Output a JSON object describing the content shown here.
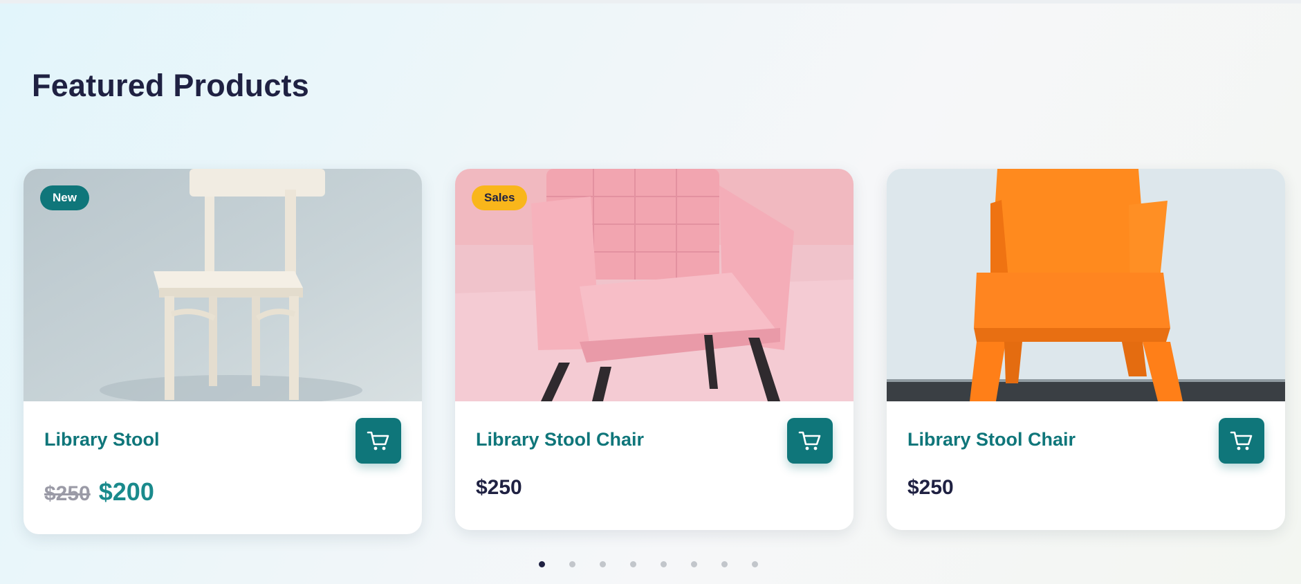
{
  "section": {
    "title": "Featured Products"
  },
  "products": [
    {
      "badge": "New",
      "name": "Library Stool",
      "old_price": "$250",
      "price": "$200",
      "image": "white-wooden-chair"
    },
    {
      "badge": "Sales",
      "name": "Library Stool Chair",
      "price": "$250",
      "image": "pink-armchair"
    },
    {
      "name": "Library Stool Chair",
      "price": "$250",
      "image": "orange-plastic-chair"
    }
  ],
  "carousel": {
    "dot_count": 8,
    "active_index": 0
  },
  "colors": {
    "accent": "#0f767a",
    "badge_sales": "#f9b61b",
    "title": "#1f2142"
  },
  "icons": {
    "cart": "cart-icon"
  }
}
